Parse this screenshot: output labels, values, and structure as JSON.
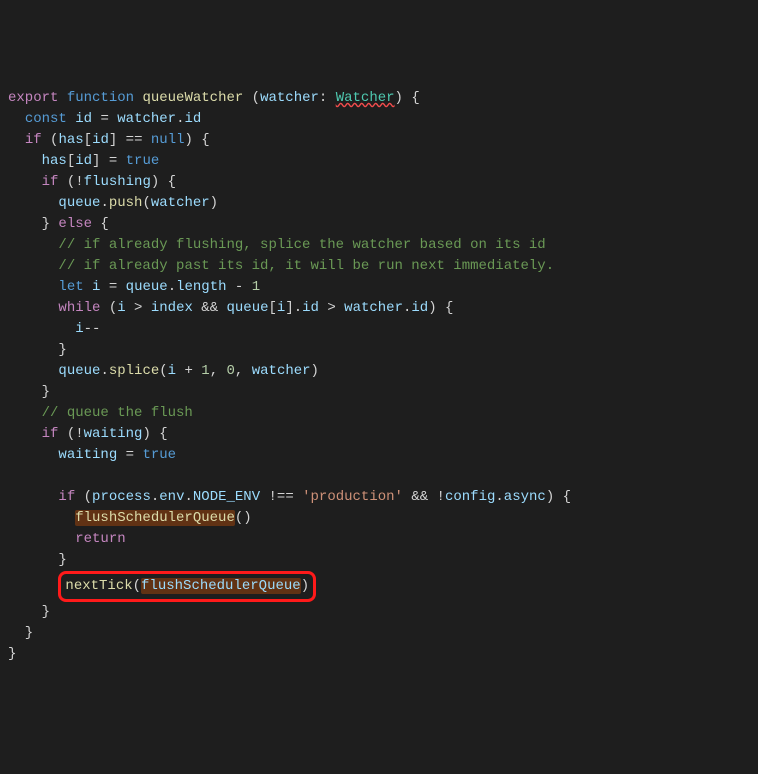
{
  "l1": {
    "export": "export",
    "function": "function",
    "fnName": "queueWatcher",
    "paren1": " (",
    "param": "watcher",
    "colon": ": ",
    "type": "Watcher",
    "paren2": ") ",
    "brace": "{"
  },
  "l2": {
    "indent": "  ",
    "const": "const",
    "sp": " ",
    "id": "id",
    "eq": " = ",
    "watcher": "watcher",
    "dot": ".",
    "prop": "id"
  },
  "l3": {
    "indent": "  ",
    "if": "if",
    "sp": " (",
    "has": "has",
    "br1": "[",
    "id": "id",
    "br2": "] == ",
    "null": "null",
    "end": ") {"
  },
  "l4": {
    "indent": "    ",
    "has": "has",
    "br1": "[",
    "id": "id",
    "br2": "] = ",
    "true": "true"
  },
  "l5": {
    "indent": "    ",
    "if": "if",
    "sp": " (!",
    "flushing": "flushing",
    "end": ") {"
  },
  "l6": {
    "indent": "      ",
    "queue": "queue",
    "dot": ".",
    "push": "push",
    "paren1": "(",
    "watcher": "watcher",
    "paren2": ")"
  },
  "l7": {
    "indent": "    } ",
    "else": "else",
    "end": " {"
  },
  "l8": {
    "indent": "      ",
    "comment": "// if already flushing, splice the watcher based on its id"
  },
  "l9": {
    "indent": "      ",
    "comment": "// if already past its id, it will be run next immediately."
  },
  "l10": {
    "indent": "      ",
    "let": "let",
    "sp": " ",
    "i": "i",
    "eq": " = ",
    "queue": "queue",
    "dot": ".",
    "length": "length",
    "minus": " - ",
    "one": "1"
  },
  "l11": {
    "indent": "      ",
    "while": "while",
    "sp": " (",
    "i": "i",
    "gt": " > ",
    "index": "index",
    "and": " && ",
    "queue": "queue",
    "br1": "[",
    "i2": "i",
    "br2": "].",
    "id": "id",
    "gt2": " > ",
    "watcher": "watcher",
    "dot": ".",
    "id2": "id",
    "end": ") {"
  },
  "l12": {
    "indent": "        ",
    "i": "i",
    "dec": "--"
  },
  "l13": {
    "indent": "      }"
  },
  "l14": {
    "indent": "      ",
    "queue": "queue",
    "dot": ".",
    "splice": "splice",
    "paren1": "(",
    "i": "i",
    "plus": " + ",
    "one": "1",
    "comma1": ", ",
    "zero": "0",
    "comma2": ", ",
    "watcher": "watcher",
    "paren2": ")"
  },
  "l15": {
    "indent": "    }"
  },
  "l16": {
    "indent": "    ",
    "comment": "// queue the flush"
  },
  "l17": {
    "indent": "    ",
    "if": "if",
    "sp": " (!",
    "waiting": "waiting",
    "end": ") {"
  },
  "l18": {
    "indent": "      ",
    "waiting": "waiting",
    "eq": " = ",
    "true": "true"
  },
  "l19": " ",
  "l20": {
    "indent": "      ",
    "if": "if",
    "sp": " (",
    "process": "process",
    "dot1": ".",
    "env": "env",
    "dot2": ".",
    "nodeenv": "NODE_ENV",
    "neq": " !== ",
    "str": "'production'",
    "and": " && !",
    "config": "config",
    "dot3": ".",
    "async": "async",
    "end": ") {"
  },
  "l21": {
    "indent": "        ",
    "fn": "flushSchedulerQueue",
    "paren": "()"
  },
  "l22": {
    "indent": "        ",
    "return": "return"
  },
  "l23": {
    "indent": "      }"
  },
  "l24": {
    "indent": "      ",
    "nextTick": "nextTick",
    "paren1": "(",
    "fn": "flushSchedulerQueue",
    "paren2": ")"
  },
  "l25": {
    "indent": "    }"
  },
  "l26": {
    "indent": "  }"
  },
  "l27": {
    "indent": "}"
  }
}
